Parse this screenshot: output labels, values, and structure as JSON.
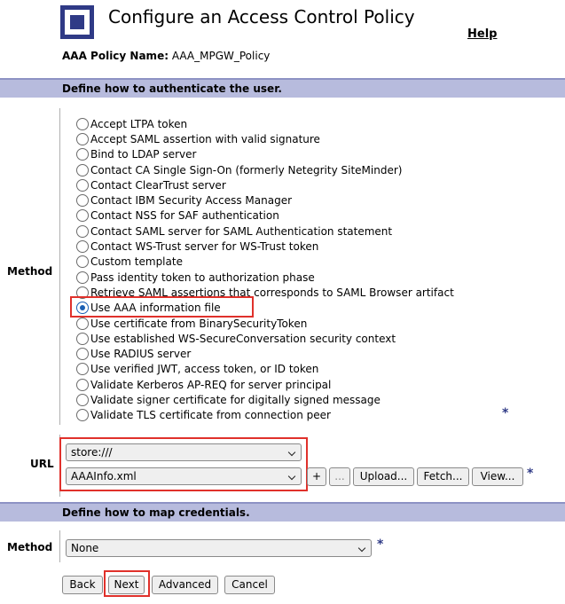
{
  "header": {
    "title": "Configure an Access Control Policy",
    "help_label": "Help"
  },
  "policy": {
    "label": "AAA Policy Name:",
    "value": "AAA_MPGW_Policy"
  },
  "authenticate": {
    "section_title": "Define how to authenticate the user.",
    "method_label": "Method",
    "options": [
      {
        "label": "Accept LTPA token",
        "checked": false
      },
      {
        "label": "Accept SAML assertion with valid signature",
        "checked": false
      },
      {
        "label": "Bind to LDAP server",
        "checked": false
      },
      {
        "label": "Contact CA Single Sign-On (formerly Netegrity SiteMinder)",
        "checked": false
      },
      {
        "label": "Contact ClearTrust server",
        "checked": false
      },
      {
        "label": "Contact IBM Security Access Manager",
        "checked": false
      },
      {
        "label": "Contact NSS for SAF authentication",
        "checked": false
      },
      {
        "label": "Contact SAML server for SAML Authentication statement",
        "checked": false
      },
      {
        "label": "Contact WS-Trust server for WS-Trust token",
        "checked": false
      },
      {
        "label": "Custom template",
        "checked": false
      },
      {
        "label": "Pass identity token to authorization phase",
        "checked": false
      },
      {
        "label": "Retrieve SAML assertions that corresponds to SAML Browser artifact",
        "checked": false
      },
      {
        "label": "Use AAA information file",
        "checked": true
      },
      {
        "label": "Use certificate from BinarySecurityToken",
        "checked": false
      },
      {
        "label": "Use established WS-SecureConversation security context",
        "checked": false
      },
      {
        "label": "Use RADIUS server",
        "checked": false
      },
      {
        "label": "Use verified JWT, access token, or ID token",
        "checked": false
      },
      {
        "label": "Validate Kerberos AP-REQ for server principal",
        "checked": false
      },
      {
        "label": "Validate signer certificate for digitally signed message",
        "checked": false
      },
      {
        "label": "Validate TLS certificate from connection peer",
        "checked": false
      }
    ],
    "required_marker": "*"
  },
  "url": {
    "label": "URL",
    "store_value": "store:///",
    "file_value": "AAAInfo.xml",
    "plus_label": "+",
    "ellipsis_label": "...",
    "upload_label": "Upload...",
    "fetch_label": "Fetch...",
    "view_label": "View...",
    "required_marker": "*"
  },
  "credentials": {
    "section_title": "Define how to map credentials.",
    "method_label": "Method",
    "method_value": "None",
    "required_marker": "*"
  },
  "footer": {
    "back_label": "Back",
    "next_label": "Next",
    "advanced_label": "Advanced",
    "cancel_label": "Cancel"
  },
  "colors": {
    "section_bar": "#b7bbdd",
    "brand": "#2f3a86",
    "highlight": "#e0312b",
    "radio_selected": "#1a5fb4"
  }
}
